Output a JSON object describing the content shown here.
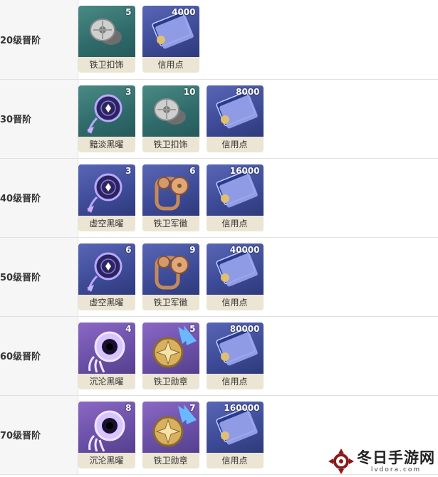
{
  "rows": [
    {
      "level": "20级晋阶",
      "items": [
        {
          "name": "铁卫扣饰",
          "count": "5",
          "rarity": "rar3",
          "icon": "iron-clasp-icon"
        },
        {
          "name": "信用点",
          "count": "4000",
          "rarity": "rar4",
          "icon": "credit-card-icon"
        }
      ]
    },
    {
      "level": "30晋阶",
      "items": [
        {
          "name": "黯淡黑曜",
          "count": "3",
          "rarity": "rar3",
          "icon": "dreamcatcher-icon"
        },
        {
          "name": "铁卫扣饰",
          "count": "10",
          "rarity": "rar3",
          "icon": "iron-clasp-icon"
        },
        {
          "name": "信用点",
          "count": "8000",
          "rarity": "rar4",
          "icon": "credit-card-icon"
        }
      ]
    },
    {
      "level": "40级晋阶",
      "items": [
        {
          "name": "虚空黑曜",
          "count": "3",
          "rarity": "rar4",
          "icon": "dreamcatcher-icon"
        },
        {
          "name": "铁卫军徽",
          "count": "6",
          "rarity": "rar4",
          "icon": "bronze-insignia-icon"
        },
        {
          "name": "信用点",
          "count": "16000",
          "rarity": "rar4",
          "icon": "credit-card-icon"
        }
      ]
    },
    {
      "level": "50级晋阶",
      "items": [
        {
          "name": "虚空黑曜",
          "count": "6",
          "rarity": "rar4",
          "icon": "dreamcatcher-icon"
        },
        {
          "name": "铁卫军徽",
          "count": "9",
          "rarity": "rar4",
          "icon": "bronze-insignia-icon"
        },
        {
          "name": "信用点",
          "count": "40000",
          "rarity": "rar4",
          "icon": "credit-card-icon"
        }
      ]
    },
    {
      "level": "60级晋阶",
      "items": [
        {
          "name": "沉沦黑曜",
          "count": "4",
          "rarity": "rar5",
          "icon": "dark-orb-icon"
        },
        {
          "name": "铁卫勋章",
          "count": "5",
          "rarity": "rar5",
          "icon": "gold-medal-icon"
        },
        {
          "name": "信用点",
          "count": "80000",
          "rarity": "rar4",
          "icon": "credit-card-icon"
        }
      ]
    },
    {
      "level": "70级晋阶",
      "items": [
        {
          "name": "沉沦黑曜",
          "count": "8",
          "rarity": "rar5",
          "icon": "dark-orb-icon"
        },
        {
          "name": "铁卫勋章",
          "count": "7",
          "rarity": "rar5",
          "icon": "gold-medal-icon"
        },
        {
          "name": "信用点",
          "count": "160000",
          "rarity": "rar4",
          "icon": "credit-card-icon"
        }
      ]
    }
  ],
  "watermark": {
    "title": "冬日手游网",
    "url": "lvdora.com"
  },
  "colors": {
    "rarity3": "#2f6a6a",
    "rarity4": "#3d4a96",
    "rarity5": "#6a4fa6",
    "label_bg": "#ece5d3",
    "row_label_bg": "#f6f6f6"
  }
}
